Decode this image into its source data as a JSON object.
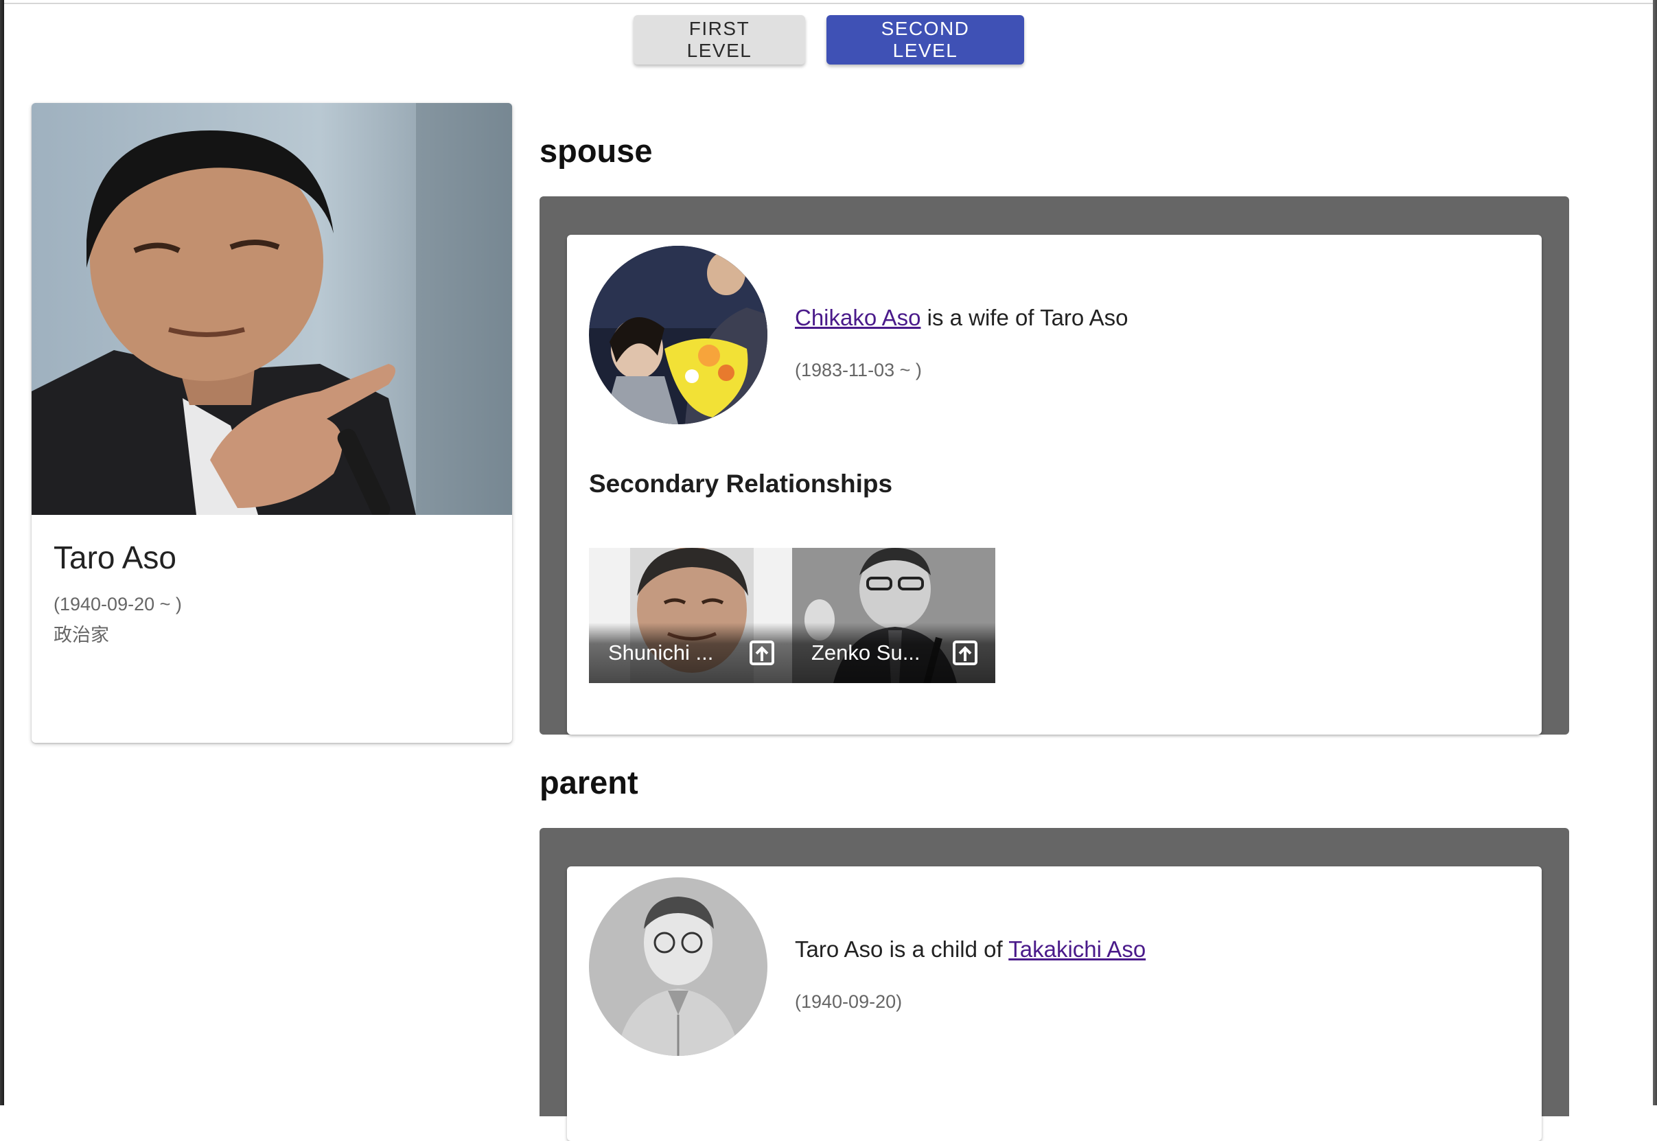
{
  "toolbar": {
    "first_level_label": "FIRST LEVEL",
    "second_level_label": "SECOND LEVEL",
    "active": "SECOND LEVEL"
  },
  "profile": {
    "name": "Taro Aso",
    "dates": "(1940-09-20 ~ )",
    "occupation": "政治家",
    "link_icon": "link-icon"
  },
  "sections": {
    "spouse": {
      "heading": "spouse",
      "person_name": "Chikako Aso",
      "relation_text": " is a wife of Taro Aso",
      "dates": "(1983-11-03 ~ )",
      "secondary_heading": "Secondary Relationships",
      "secondary": [
        {
          "label": "Shunichi ...",
          "icon": "open-in-icon"
        },
        {
          "label": "Zenko Su...",
          "icon": "open-in-icon"
        }
      ]
    },
    "parent": {
      "heading": "parent",
      "relation_prefix": "Taro Aso is a child of ",
      "person_name": "Takakichi Aso",
      "dates": "(1940-09-20)"
    }
  },
  "colors": {
    "primary": "#3f51b5",
    "panel": "#666666",
    "link_visited": "#4a1a8a",
    "link_icon": "#1a2bd6"
  }
}
